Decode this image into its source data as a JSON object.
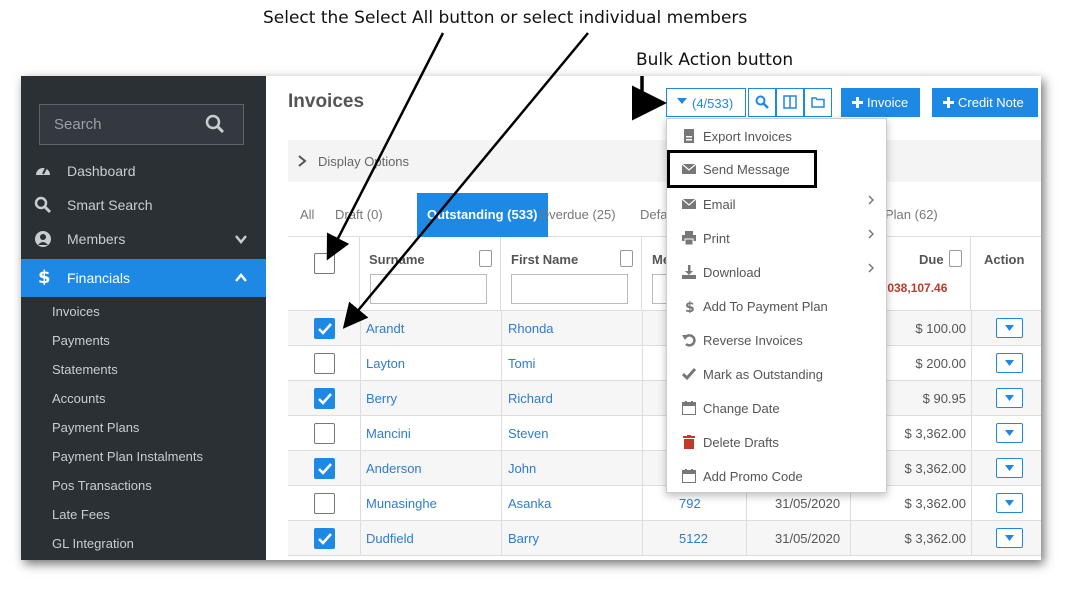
{
  "annotations": {
    "select_all": "Select the Select All button or select individual members",
    "bulk_action": "Bulk Action button"
  },
  "colors": {
    "accent": "#1e88e5",
    "sidebar": "#2b3035",
    "link": "#2f7ccd",
    "total": "#c0392b"
  },
  "sidebar": {
    "search_placeholder": "Search",
    "nav": [
      {
        "label": "Dashboard",
        "icon": "dashboard-icon"
      },
      {
        "label": "Smart Search",
        "icon": "search-icon"
      },
      {
        "label": "Members",
        "icon": "user-icon"
      },
      {
        "label": "Financials",
        "icon": "dollar-icon"
      }
    ],
    "sub_items": [
      "Invoices",
      "Payments",
      "Statements",
      "Accounts",
      "Payment Plans",
      "Payment Plan Instalments",
      "Pos Transactions",
      "Late Fees",
      "GL Integration"
    ]
  },
  "header": {
    "title": "Invoices",
    "bulk_label": "(4/533)",
    "invoice_btn": "Invoice",
    "credit_note_btn": "Credit Note"
  },
  "display_options": "Display Options",
  "tabs": [
    {
      "label": "All"
    },
    {
      "label": "Draft (0)"
    },
    {
      "label": "Outstanding (533)"
    },
    {
      "label": "Overdue (25)"
    },
    {
      "label": "Defa"
    },
    {
      "label": "Plan (62)"
    }
  ],
  "table": {
    "headers": {
      "surname": "Surname",
      "first_name": "First Name",
      "member": "Me",
      "due": "Due",
      "action": "Action"
    },
    "due_total": ",038,107.46",
    "rows": [
      {
        "checked": true,
        "surname": "Arandt",
        "first": "Rhonda",
        "member": "",
        "date": "",
        "due": "$ 100.00"
      },
      {
        "checked": false,
        "surname": "Layton",
        "first": "Tomi",
        "member": "",
        "date": "",
        "due": "$ 200.00"
      },
      {
        "checked": true,
        "surname": "Berry",
        "first": "Richard",
        "member": "",
        "date": "",
        "due": "$ 90.95"
      },
      {
        "checked": false,
        "surname": "Mancini",
        "first": "Steven",
        "member": "",
        "date": "",
        "due": "$ 3,362.00"
      },
      {
        "checked": true,
        "surname": "Anderson",
        "first": "John",
        "member": "",
        "date": "",
        "due": "$ 3,362.00"
      },
      {
        "checked": false,
        "surname": "Munasinghe",
        "first": "Asanka",
        "member": "792",
        "date": "31/05/2020",
        "due": "$ 3,362.00"
      },
      {
        "checked": true,
        "surname": "Dudfield",
        "first": "Barry",
        "member": "5122",
        "date": "31/05/2020",
        "due": "$ 3,362.00"
      }
    ]
  },
  "dropdown": [
    {
      "label": "Export Invoices",
      "icon": "file-icon"
    },
    {
      "label": "Send Message",
      "icon": "envelope-icon"
    },
    {
      "label": "Email",
      "icon": "envelope-icon"
    },
    {
      "label": "Print",
      "icon": "print-icon"
    },
    {
      "label": "Download",
      "icon": "download-icon"
    },
    {
      "label": "Add To Payment Plan",
      "icon": "dollar-icon"
    },
    {
      "label": "Reverse Invoices",
      "icon": "undo-icon"
    },
    {
      "label": "Mark as Outstanding",
      "icon": "check-icon"
    },
    {
      "label": "Change Date",
      "icon": "calendar-icon"
    },
    {
      "label": "Delete Drafts",
      "icon": "trash-icon"
    },
    {
      "label": "Add Promo Code",
      "icon": "calendar-icon"
    }
  ]
}
